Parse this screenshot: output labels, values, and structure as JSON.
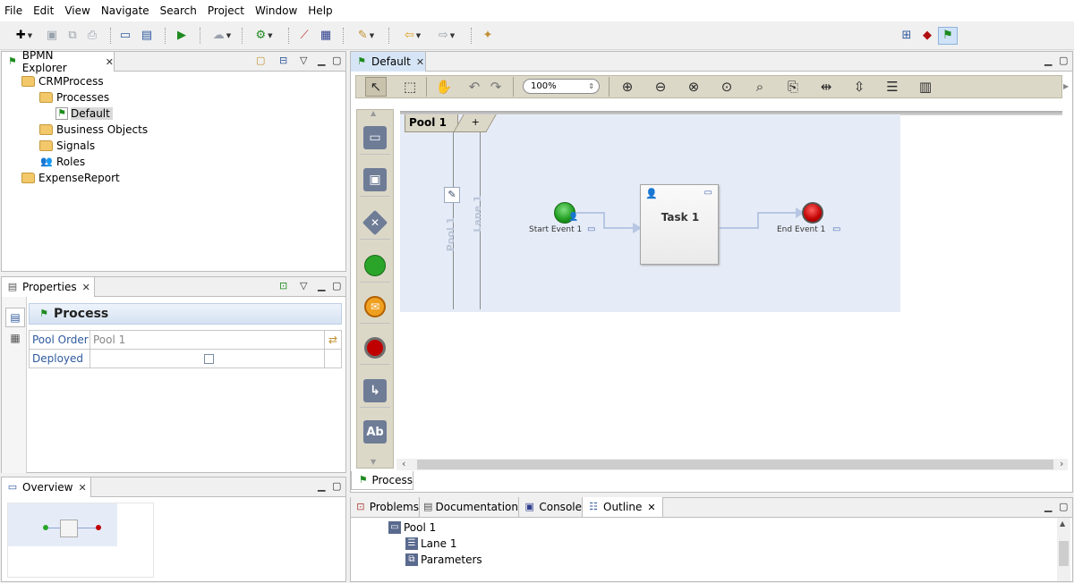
{
  "menu": [
    "File",
    "Edit",
    "View",
    "Navigate",
    "Search",
    "Project",
    "Window",
    "Help"
  ],
  "explorer": {
    "title": "BPMN Explorer",
    "tree": [
      {
        "label": "CRMProcess",
        "level": 0
      },
      {
        "label": "Processes",
        "level": 1
      },
      {
        "label": "Default",
        "level": 2,
        "selected": true
      },
      {
        "label": "Business Objects",
        "level": 1
      },
      {
        "label": "Signals",
        "level": 1
      },
      {
        "label": "Roles",
        "level": 1
      },
      {
        "label": "ExpenseReport",
        "level": 0
      }
    ]
  },
  "properties": {
    "title": "Properties",
    "header": "Process",
    "rows": [
      {
        "name": "Pool Order",
        "value": "Pool 1"
      },
      {
        "name": "Deployed",
        "value": ""
      }
    ]
  },
  "overview": {
    "title": "Overview"
  },
  "editor": {
    "tab": "Default",
    "zoom": "100%",
    "bottom_tab": "Process",
    "pool_tab": "Pool 1",
    "pool_add": "+",
    "pool_label": "Pool 1",
    "lane_label": "Lane 1",
    "start_event": "Start Event 1",
    "task": "Task 1",
    "end_event": "End Event 1",
    "palette_text_tool": "Ab"
  },
  "bottom": {
    "tabs": [
      "Problems",
      "Documentation",
      "Console",
      "Outline"
    ],
    "outline": [
      {
        "label": "Pool 1",
        "level": 0
      },
      {
        "label": "Lane 1",
        "level": 1
      },
      {
        "label": "Parameters",
        "level": 1
      }
    ]
  },
  "colors": {
    "accent": "#2f5a9e",
    "pool_bg": "#e6ecf7",
    "start": "#2aa52a",
    "end": "#c00000",
    "palette_bg": "#dcd8c8"
  }
}
